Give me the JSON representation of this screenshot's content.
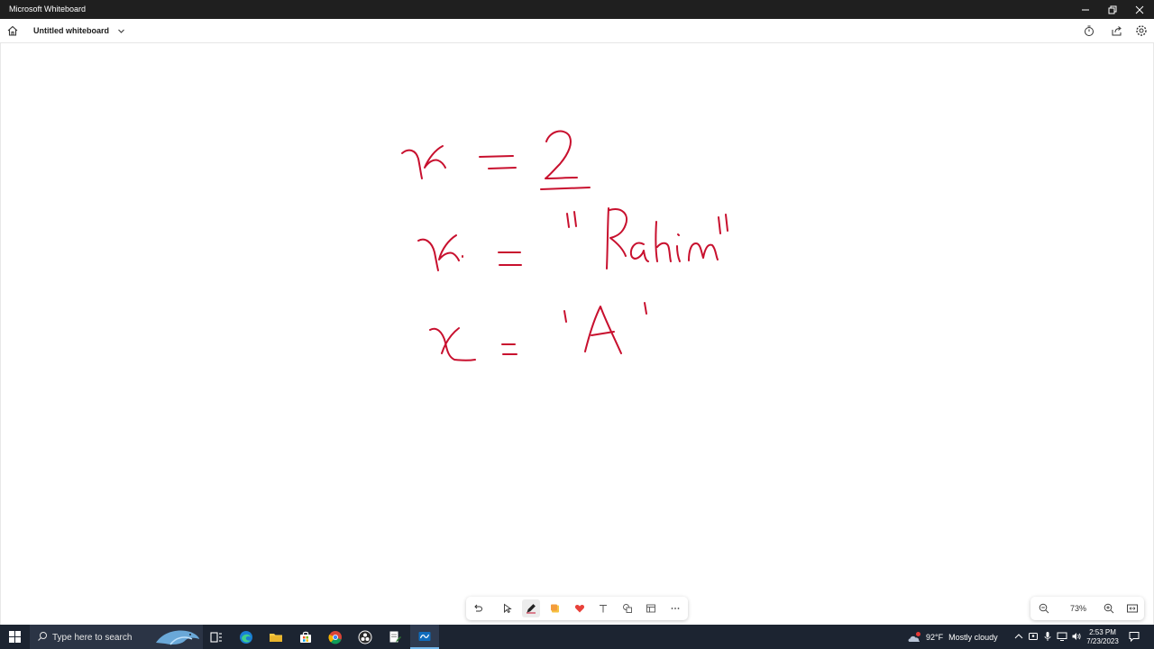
{
  "window": {
    "title": "Microsoft Whiteboard"
  },
  "appbar": {
    "board_title": "Untitled whiteboard"
  },
  "canvas": {
    "ink_color": "#c8102e",
    "handwriting_lines": [
      "x = 2",
      "x = \"Rahim\"",
      "x = 'A'"
    ]
  },
  "toolbar": {
    "tools": [
      "undo",
      "select",
      "pen",
      "sticky-note",
      "reactions",
      "text",
      "shapes",
      "templates",
      "more"
    ],
    "active_tool": "pen"
  },
  "zoom": {
    "level": "73%"
  },
  "taskbar": {
    "search_placeholder": "Type here to search",
    "weather_temp": "92°F",
    "weather_text": "Mostly cloudy",
    "time": "2:53 PM",
    "date": "7/23/2023"
  },
  "colors": {
    "titlebar": "#1f1f1f",
    "taskbar": "#1c2431",
    "accent": "#76b9ed",
    "ink": "#c8102e"
  }
}
